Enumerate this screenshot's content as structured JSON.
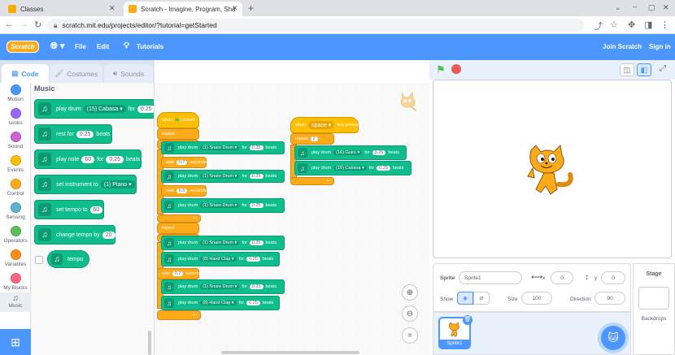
{
  "browser": {
    "tabs": [
      {
        "title": "Classes",
        "active": false
      },
      {
        "title": "Scratch - Imagine, Program, Sha",
        "active": true
      }
    ],
    "url": "scratch.mit.edu/projects/editor/?tutorial=getStarted"
  },
  "menu": {
    "logo": "Scratch",
    "file": "File",
    "edit": "Edit",
    "tutorials": "Tutorials",
    "join": "Join Scratch",
    "signin": "Sign in"
  },
  "editor_tabs": {
    "code": "Code",
    "costumes": "Costumes",
    "sounds": "Sounds"
  },
  "categories": [
    {
      "label": "Motion",
      "color": "#4c97ff"
    },
    {
      "label": "Looks",
      "color": "#9966ff"
    },
    {
      "label": "Sound",
      "color": "#cf63cf"
    },
    {
      "label": "Events",
      "color": "#ffbf00"
    },
    {
      "label": "Control",
      "color": "#ffab19"
    },
    {
      "label": "Sensing",
      "color": "#5cb1d6"
    },
    {
      "label": "Operators",
      "color": "#59c059"
    },
    {
      "label": "Variables",
      "color": "#ff8c1a"
    },
    {
      "label": "My Blocks",
      "color": "#ff6680"
    },
    {
      "label": "Music",
      "color": "#0fbd8c"
    }
  ],
  "palette": {
    "heading": "Music",
    "play_drum": {
      "a": "play drum",
      "drum": "(15) Cabasa",
      "b": "for",
      "beats": "0.25"
    },
    "rest": {
      "a": "rest for",
      "beats": "0.25",
      "b": "beats"
    },
    "play_note": {
      "a": "play note",
      "note": "60",
      "b": "for",
      "beats": "0.25",
      "c": "beats"
    },
    "set_instrument": {
      "a": "set instrument to",
      "instrument": "(1) Piano"
    },
    "set_tempo": {
      "a": "set tempo to",
      "value": "60"
    },
    "change_tempo": {
      "a": "change tempo by",
      "value": "20"
    },
    "tempo": "tempo"
  },
  "script": {
    "when_clicked": {
      "a": "when",
      "b": "clicked"
    },
    "repeat1": "2",
    "repeat2": "3",
    "repeat3": "2",
    "repeat_label": "repeat",
    "wait_label": "wait",
    "seconds": "seconds",
    "for": "for",
    "beats": "beats",
    "play_drum": "play drum",
    "snare": "(1) Snare Drum",
    "handclap": "(8) Hand Clap",
    "guiro": "(16) Guiro",
    "cabasa": "(15) Cabasa",
    "b025": "0.25",
    "w07": "0.7",
    "w05": "0.5",
    "when_key": {
      "a": "when",
      "key": "space",
      "b": "key pressed"
    }
  },
  "sprite_info": {
    "sprite_label": "Sprite",
    "sprite_name": "Sprite1",
    "x_label": "x",
    "x": "0",
    "y_label": "y",
    "y": "0",
    "show_label": "Show",
    "size_label": "Size",
    "size": "100",
    "direction_label": "Direction",
    "direction": "90"
  },
  "sprite_list": {
    "sprite1": "Sprite1"
  },
  "stage_panel": {
    "title": "Stage",
    "backdrops": "Backdrops"
  }
}
